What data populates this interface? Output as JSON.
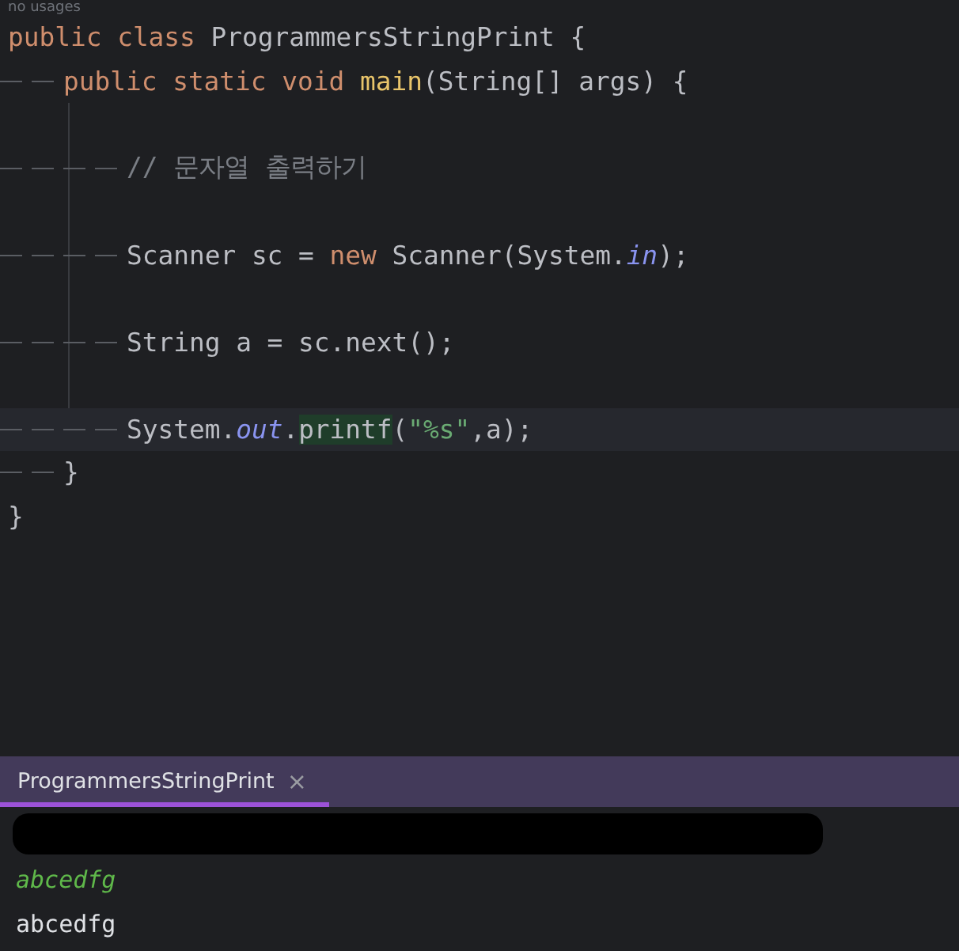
{
  "editor": {
    "hint": "no usages",
    "code": [
      {
        "kind": "code",
        "current": false,
        "tokens": [
          {
            "kind": "keyword",
            "text": "public class "
          },
          {
            "kind": "plain",
            "text": "ProgrammersStringPrint {"
          }
        ],
        "children": [
          {
            "kind": "code",
            "current": false,
            "tokens": [
              {
                "kind": "keyword",
                "text": "public static void "
              },
              {
                "kind": "method",
                "text": "main"
              },
              {
                "kind": "plain",
                "text": "(String[] args) {"
              }
            ],
            "children": [
              {
                "kind": "blank"
              },
              {
                "kind": "code",
                "current": false,
                "tokens": [
                  {
                    "kind": "comment",
                    "text": "// 문자열 출력하기"
                  }
                ]
              },
              {
                "kind": "blank"
              },
              {
                "kind": "code",
                "current": false,
                "tokens": [
                  {
                    "kind": "plain",
                    "text": "Scanner sc = "
                  },
                  {
                    "kind": "keyword",
                    "text": "new "
                  },
                  {
                    "kind": "plain",
                    "text": "Scanner(System."
                  },
                  {
                    "kind": "field",
                    "text": "in"
                  },
                  {
                    "kind": "plain",
                    "text": ");"
                  }
                ]
              },
              {
                "kind": "blank"
              },
              {
                "kind": "code",
                "current": false,
                "tokens": [
                  {
                    "kind": "plain",
                    "text": "String a = sc.next();"
                  }
                ]
              },
              {
                "kind": "blank"
              },
              {
                "kind": "code",
                "current": true,
                "tokens": [
                  {
                    "kind": "plain",
                    "text": "System."
                  },
                  {
                    "kind": "field",
                    "text": "out"
                  },
                  {
                    "kind": "plain",
                    "text": "."
                  },
                  {
                    "kind": "match",
                    "text": "printf"
                  },
                  {
                    "kind": "plain",
                    "text": "("
                  },
                  {
                    "kind": "string",
                    "text": "\"%s\""
                  },
                  {
                    "kind": "plain",
                    "text": ",a);"
                  }
                ]
              }
            ]
          },
          {
            "kind": "code",
            "current": false,
            "tokens": [
              {
                "kind": "plain",
                "text": "}"
              }
            ]
          }
        ]
      },
      {
        "kind": "code",
        "current": false,
        "tokens": [
          {
            "kind": "plain",
            "text": "}"
          }
        ]
      }
    ]
  },
  "console": {
    "tabs": [
      {
        "label": "ProgrammersStringPrint",
        "selected": true,
        "close": "×"
      }
    ],
    "output": [
      {
        "kind": "redacted"
      },
      {
        "kind": "input",
        "text": "abcedfg"
      },
      {
        "kind": "output",
        "text": "abcedfg"
      }
    ]
  }
}
